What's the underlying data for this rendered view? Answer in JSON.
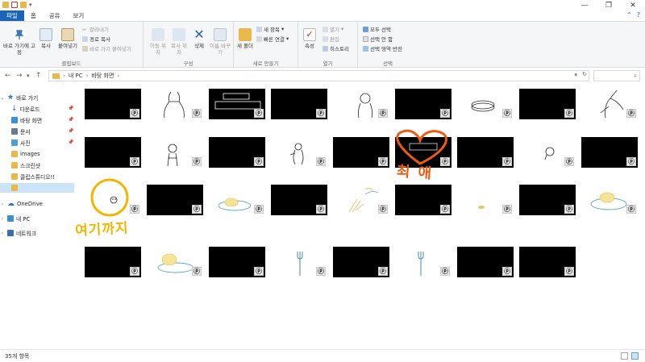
{
  "ribbon_tabs": [
    "파일",
    "홈",
    "공유",
    "보기"
  ],
  "clipboard": {
    "pin_label": "바로 가기에 고정",
    "copy_label": "복사",
    "paste_label": "붙여넣기",
    "cut_label": "잘라내기",
    "copy_path_label": "경로 복사",
    "paste_shortcut_label": "바로 가기 붙여넣기",
    "group_label": "클립보드"
  },
  "organize": {
    "move_label": "이동 위치",
    "copy_to_label": "복사 위치",
    "delete_label": "삭제",
    "rename_label": "이름 바꾸기",
    "group_label": "구성"
  },
  "new": {
    "new_folder_label": "새 폴더",
    "new_item_label": "새 항목",
    "easy_access_label": "빠른 연결",
    "group_label": "새로 만들기"
  },
  "open": {
    "properties_label": "속성",
    "open_label": "열기",
    "edit_label": "편집",
    "history_label": "히스토리",
    "group_label": "열기"
  },
  "select": {
    "select_all_label": "모두 선택",
    "select_none_label": "선택 안 함",
    "invert_label": "선택 영역 반전",
    "group_label": "선택"
  },
  "address": {
    "segments": [
      "내 PC",
      "바탕 화면"
    ]
  },
  "nav_pane": {
    "quick_access": "바로 가기",
    "items": [
      "다운로드",
      "바탕 화면",
      "문서",
      "사진",
      "images",
      "스크린샷",
      "클립스튜디오!!"
    ],
    "onedrive": "OneDrive",
    "this_pc": "내 PC",
    "network": "네트워크"
  },
  "status": {
    "item_count": "35개 항목"
  },
  "annotations": {
    "handwritten_1": "여기까지",
    "handwritten_2": "최애"
  },
  "colors": {
    "accent": "#1a64b8",
    "highlight_yellow": "#f2b600",
    "highlight_orange": "#f05a10"
  }
}
